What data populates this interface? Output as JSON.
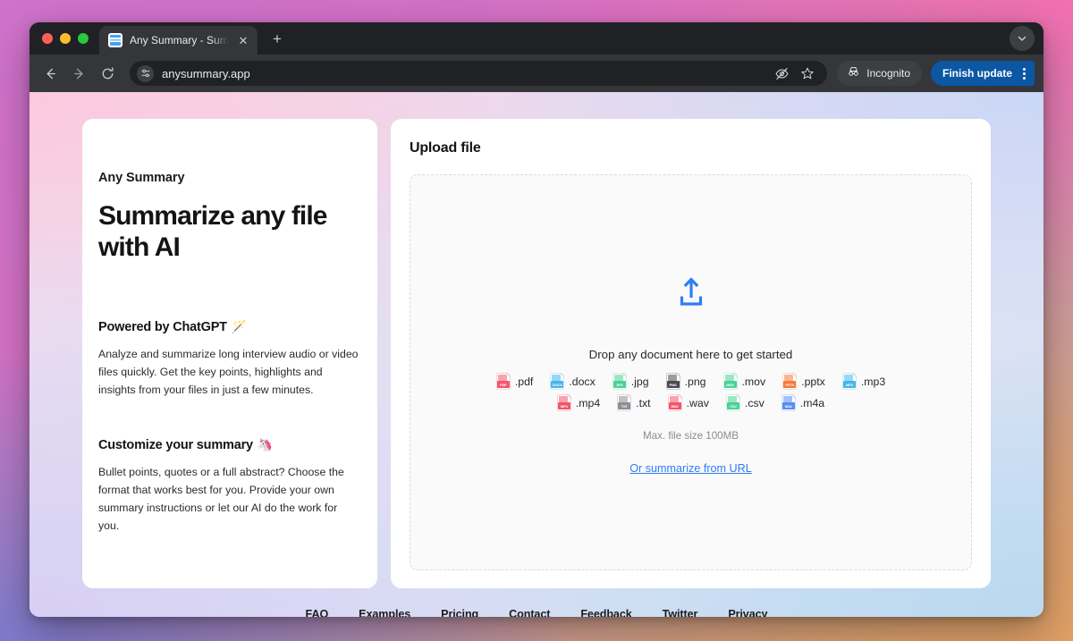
{
  "browser": {
    "tab": {
      "title": "Any Summary - Summarize a",
      "favicon_icon": "document-favicon",
      "close_icon": "close-icon"
    },
    "new_tab_icon": "plus-icon",
    "tab_list_icon": "chevron-down-icon",
    "toolbar": {
      "back_icon": "arrow-left-icon",
      "forward_icon": "arrow-right-icon",
      "reload_icon": "reload-icon",
      "site_settings_icon": "tune-icon",
      "url": "anysummary.app",
      "tracking_protection_icon": "eye-slash-icon",
      "bookmark_icon": "star-icon",
      "incognito_icon": "incognito-hat-icon",
      "incognito_label": "Incognito",
      "update_label": "Finish update",
      "menu_icon": "kebab-menu-icon"
    }
  },
  "left_panel": {
    "brand": "Any Summary",
    "headline": "Summarize any file with AI",
    "features": [
      {
        "title": "Powered by ChatGPT",
        "emoji": "🪄",
        "emoji_name": "magic-wand-emoji",
        "body": "Analyze and summarize long interview audio or video files quickly. Get the key points, highlights and insights from your files in just a few minutes."
      },
      {
        "title": "Customize your summary",
        "emoji": "🦄",
        "emoji_name": "unicorn-emoji",
        "body": "Bullet points, quotes or a full abstract? Choose the format that works best for you. Provide your own summary instructions or let our AI do the work for you."
      }
    ]
  },
  "upload_panel": {
    "title": "Upload file",
    "upload_icon": "upload-tray-icon",
    "drop_text": "Drop any document here to get started",
    "file_types_row1": [
      {
        "label": ".pdf",
        "tag": "PDF",
        "color": "#f4556d"
      },
      {
        "label": ".docx",
        "tag": "DOCX",
        "color": "#45b6e8"
      },
      {
        "label": ".jpg",
        "tag": "JPG",
        "color": "#4ad295"
      },
      {
        "label": ".png",
        "tag": "PNG",
        "color": "#4a4a52"
      },
      {
        "label": ".mov",
        "tag": "MOV",
        "color": "#4ad295"
      },
      {
        "label": ".pptx",
        "tag": "PPTX",
        "color": "#f47a3c"
      },
      {
        "label": ".mp3",
        "tag": "MP3",
        "color": "#45b6e8"
      }
    ],
    "file_types_row2": [
      {
        "label": ".mp4",
        "tag": "MP4",
        "color": "#f4556d"
      },
      {
        "label": ".txt",
        "tag": "TXT",
        "color": "#8d8d96"
      },
      {
        "label": ".wav",
        "tag": "WAV",
        "color": "#f4556d"
      },
      {
        "label": ".csv",
        "tag": "CSV",
        "color": "#4ad295"
      },
      {
        "label": ".m4a",
        "tag": "M4A",
        "color": "#5b8def"
      }
    ],
    "max_size": "Max. file size 100MB",
    "url_link": "Or summarize from URL",
    "accent_color": "#2f7df6"
  },
  "footer": {
    "links": [
      "FAQ",
      "Examples",
      "Pricing",
      "Contact",
      "Feedback",
      "Twitter",
      "Privacy"
    ]
  }
}
